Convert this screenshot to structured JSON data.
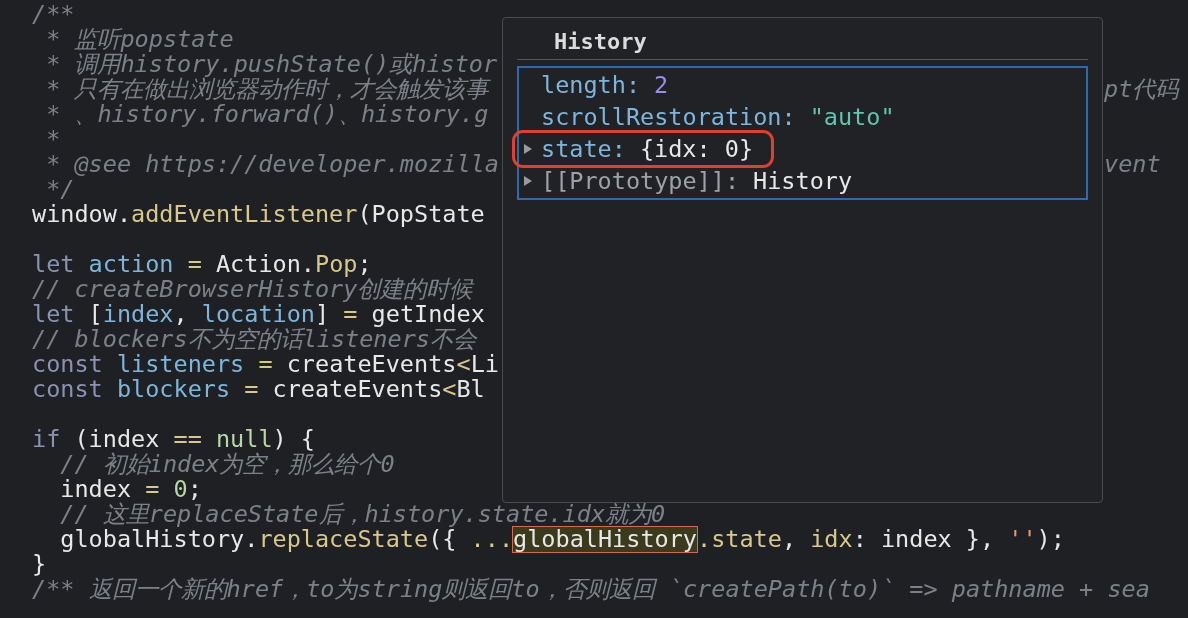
{
  "code_blocks": [
    {
      "lines": [
        {
          "tokens": [
            {
              "text": "/**",
              "kind": "comment"
            }
          ]
        },
        {
          "tokens": [
            {
              "text": " * 监听popstate",
              "kind": "comment"
            }
          ]
        },
        {
          "tokens": [
            {
              "text": " * 调用history.pushState()或histor",
              "kind": "comment"
            }
          ]
        },
        {
          "tokens": [
            {
              "text": " * 只有在做出浏览器动作时，才会触发该事",
              "kind": "comment"
            }
          ],
          "right_text": "pt代码"
        },
        {
          "tokens": [
            {
              "text": " * 、history.forward()、history.g",
              "kind": "comment"
            }
          ]
        },
        {
          "tokens": [
            {
              "text": " *",
              "kind": "comment"
            }
          ]
        },
        {
          "tokens": [
            {
              "text": " * @see https://developer.mozilla",
              "kind": "comment"
            }
          ],
          "right_text": "vent"
        },
        {
          "tokens": [
            {
              "text": " */",
              "kind": "comment"
            }
          ]
        },
        {
          "tokens": [
            {
              "text": "window.",
              "kind": "plain"
            },
            {
              "text": "addEventListener",
              "kind": "function"
            },
            {
              "text": "(PopState",
              "kind": "plain"
            }
          ]
        }
      ]
    },
    {
      "lines": [
        {
          "tokens": [
            {
              "text": "let ",
              "kind": "keyword"
            },
            {
              "text": "action",
              "kind": "variable"
            },
            {
              "text": " = ",
              "kind": "operator"
            },
            {
              "text": "Action.",
              "kind": "plain"
            },
            {
              "text": "Pop",
              "kind": "function"
            },
            {
              "text": ";",
              "kind": "plain"
            }
          ]
        },
        {
          "tokens": [
            {
              "text": "// createBrowserHistory创建的时候",
              "kind": "comment"
            }
          ]
        },
        {
          "tokens": [
            {
              "text": "let ",
              "kind": "keyword"
            },
            {
              "text": "[",
              "kind": "plain"
            },
            {
              "text": "index",
              "kind": "variable"
            },
            {
              "text": ", ",
              "kind": "plain"
            },
            {
              "text": "location",
              "kind": "variable"
            },
            {
              "text": "]",
              "kind": "plain"
            },
            {
              "text": " = ",
              "kind": "operator"
            },
            {
              "text": "getIndex",
              "kind": "plain"
            }
          ]
        },
        {
          "tokens": [
            {
              "text": "// blockers不为空的话listeners不会",
              "kind": "comment"
            }
          ]
        },
        {
          "tokens": [
            {
              "text": "const ",
              "kind": "keyword"
            },
            {
              "text": "listeners",
              "kind": "variable"
            },
            {
              "text": " = ",
              "kind": "operator"
            },
            {
              "text": "createEvents",
              "kind": "plain"
            },
            {
              "text": "<",
              "kind": "operator"
            },
            {
              "text": "Li",
              "kind": "plain"
            }
          ]
        },
        {
          "tokens": [
            {
              "text": "const ",
              "kind": "keyword"
            },
            {
              "text": "blockers",
              "kind": "variable"
            },
            {
              "text": " = ",
              "kind": "operator"
            },
            {
              "text": "createEvents",
              "kind": "plain"
            },
            {
              "text": "<",
              "kind": "operator"
            },
            {
              "text": "Bl",
              "kind": "plain"
            }
          ]
        }
      ]
    },
    {
      "lines": [
        {
          "tokens": [
            {
              "text": "if ",
              "kind": "keyword"
            },
            {
              "text": "(index ",
              "kind": "plain"
            },
            {
              "text": "==",
              "kind": "operator"
            },
            {
              "text": " null",
              "kind": "literal"
            },
            {
              "text": ") {",
              "kind": "plain"
            }
          ]
        },
        {
          "tokens": [
            {
              "text": "  // 初始index为空，那么给个0",
              "kind": "comment"
            }
          ]
        },
        {
          "tokens": [
            {
              "text": "  index ",
              "kind": "plain"
            },
            {
              "text": "= ",
              "kind": "operator"
            },
            {
              "text": "0",
              "kind": "literal"
            },
            {
              "text": ";",
              "kind": "plain"
            }
          ]
        },
        {
          "tokens": [
            {
              "text": "  // 这里replaceState后，history.state.idx就为0",
              "kind": "comment"
            }
          ]
        },
        {
          "tokens": [
            {
              "text": "  globalHistory.",
              "kind": "plain"
            },
            {
              "text": "replaceState",
              "kind": "function"
            },
            {
              "text": "({ ",
              "kind": "plain"
            },
            {
              "text": "...",
              "kind": "operator"
            },
            {
              "text": "globalHistory",
              "kind": "highlight"
            },
            {
              "text": ".state",
              "kind": "function"
            },
            {
              "text": ", ",
              "kind": "plain"
            },
            {
              "text": "idx",
              "kind": "function"
            },
            {
              "text": ": index }, ",
              "kind": "plain"
            },
            {
              "text": "''",
              "kind": "string"
            },
            {
              "text": ");",
              "kind": "plain"
            }
          ]
        },
        {
          "tokens": [
            {
              "text": "}",
              "kind": "plain"
            }
          ]
        },
        {
          "tokens": [
            {
              "text": "/** 返回一个新的href，to为string则返回to，否则返回 `createPath(to)` => pathname + sea",
              "kind": "comment"
            }
          ]
        }
      ]
    }
  ],
  "popup": {
    "title": "History",
    "rows": [
      {
        "key": "length:",
        "value": "2",
        "kind": "number",
        "expandable": false,
        "circled": false
      },
      {
        "key": "scrollRestoration:",
        "value": "\"auto\"",
        "kind": "string",
        "expandable": false,
        "circled": false
      },
      {
        "key": "state:",
        "value": "{idx: 0}",
        "kind": "object",
        "expandable": true,
        "circled": true
      },
      {
        "key": "[[Prototype]]:",
        "value": "History",
        "kind": "prototype",
        "expandable": true,
        "circled": false
      }
    ]
  }
}
